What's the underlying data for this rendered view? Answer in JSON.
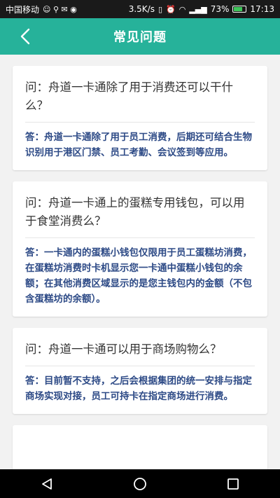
{
  "status_bar": {
    "carrier": "中国移动",
    "speed": "3.5K/s",
    "battery": "73%",
    "battery_level": 0.73,
    "time": "17:13"
  },
  "header": {
    "title": "常见问题",
    "back_icon": "chevron-left-icon"
  },
  "faq": [
    {
      "question": "问：舟道一卡通除了用于消费还可以干什么？",
      "answer": "答：舟道一卡通除了用于员工消费，后期还可结合生物识别用于港区门禁、员工考勤、会议签到等应用。"
    },
    {
      "question": "问：舟道一卡通上的蛋糕专用钱包，可以用于食堂消费么？",
      "answer": "答：一卡通内的蛋糕小钱包仅限用于员工蛋糕坊消费，在蛋糕坊消费时卡机显示您一卡通中蛋糕小钱包的余额；在其他消费区域显示的是您主钱包内的金额（不包含蛋糕坊的余额）。"
    },
    {
      "question": "问：舟道一卡通可以用于商场购物么？",
      "answer": "答：目前暂不支持，之后会根据集团的统一安排与指定商场实现对接，员工可持卡在指定商场进行消费。"
    }
  ],
  "colors": {
    "appbar": "#26b29a",
    "answer_text": "#2d4a86",
    "background": "#f2f2f2"
  }
}
